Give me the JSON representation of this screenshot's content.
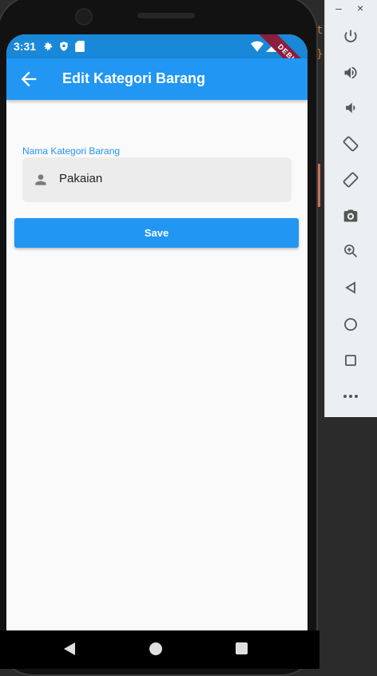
{
  "status_bar": {
    "time": "3:31"
  },
  "app_bar": {
    "title": "Edit Kategori Barang",
    "debug_banner": "DEBUG"
  },
  "form": {
    "category_label": "Nama Kategori Barang",
    "category_value": "Pakaian",
    "save_label": "Save"
  },
  "emulator": {
    "minimize": "–",
    "close": "×"
  },
  "editor": {
    "glyph1": "t",
    "glyph2": "}"
  },
  "colors": {
    "primary": "#2196f3",
    "status_bar": "#1a88d8",
    "field_bg": "#ececec"
  }
}
